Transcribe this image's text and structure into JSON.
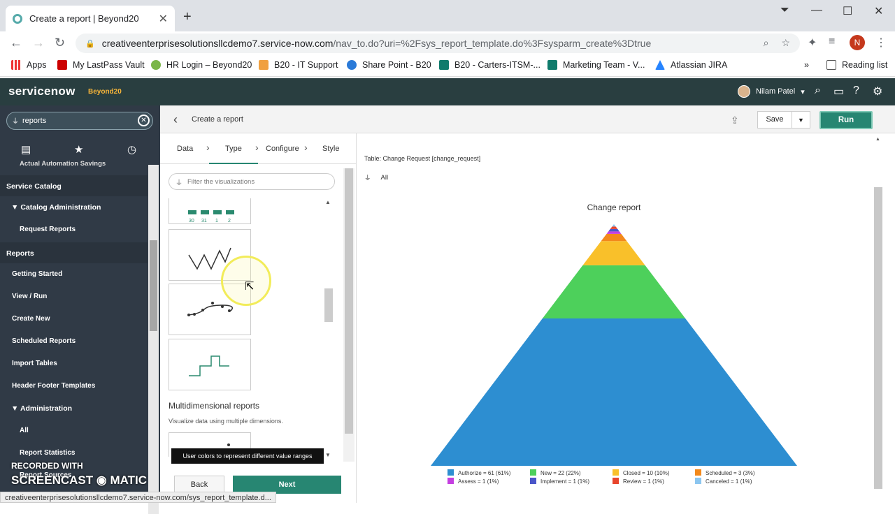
{
  "browser": {
    "tab_title": "Create a report | Beyond20",
    "url_host": "creativeenterprisesolutionsllcdemo7.service-now.com",
    "url_path": "/nav_to.do?uri=%2Fsys_report_template.do%3Fsysparm_create%3Dtrue",
    "profile_initial": "N",
    "bookmarks": [
      "Apps",
      "My LastPass Vault",
      "HR Login – Beyond20",
      "B20 - IT Support",
      "Share Point - B20",
      "B20 - Carters-ITSM-...",
      "Marketing Team - V...",
      "Atlassian JIRA"
    ],
    "reading_list": "Reading list"
  },
  "sn_header": {
    "logo": "servicenow",
    "instance": "Beyond20",
    "user_name": "Nilam Patel"
  },
  "leftnav": {
    "filter_value": "reports",
    "items": [
      {
        "label": "Actual Automation Savings",
        "type": "module"
      },
      {
        "label": "Service Catalog",
        "type": "section"
      },
      {
        "label": "Catalog Administration",
        "type": "group"
      },
      {
        "label": "Request Reports",
        "type": "module"
      },
      {
        "label": "Reports",
        "type": "section"
      },
      {
        "label": "Getting Started",
        "type": "module"
      },
      {
        "label": "View / Run",
        "type": "module"
      },
      {
        "label": "Create New",
        "type": "module"
      },
      {
        "label": "Scheduled Reports",
        "type": "module"
      },
      {
        "label": "Import Tables",
        "type": "module"
      },
      {
        "label": "Header Footer Templates",
        "type": "module"
      },
      {
        "label": "Administration",
        "type": "group"
      },
      {
        "label": "All",
        "type": "module"
      },
      {
        "label": "Report Statistics",
        "type": "module"
      },
      {
        "label": "Report Sources",
        "type": "module"
      }
    ]
  },
  "content": {
    "page_title": "Create a report",
    "save_label": "Save",
    "run_label": "Run",
    "steps": [
      "Data",
      "Type",
      "Configure",
      "Style"
    ],
    "viz_filter_placeholder": "Filter the visualizations",
    "mini_numbers": [
      "30",
      "31",
      "1",
      "2"
    ],
    "multi_title": "Multidimensional reports",
    "multi_sub": "Visualize data using multiple dimensions.",
    "tooltip": "User colors to represent different value ranges",
    "back_label": "Back",
    "next_label": "Next",
    "table_info": "Table: Change Request [change_request]",
    "filter_label": "All"
  },
  "chart_data": {
    "type": "pyramid",
    "title": "Change report",
    "series": [
      {
        "name": "Authorize = 61 (61%)",
        "category": "Authorize",
        "value": 61,
        "color": "#2d8ed1"
      },
      {
        "name": "New = 22 (22%)",
        "category": "New",
        "value": 22,
        "color": "#4dd05b"
      },
      {
        "name": "Closed = 10 (10%)",
        "category": "Closed",
        "value": 10,
        "color": "#f9c02a"
      },
      {
        "name": "Scheduled = 3 (3%)",
        "category": "Scheduled",
        "value": 3,
        "color": "#f2891c"
      },
      {
        "name": "Assess = 1 (1%)",
        "category": "Assess",
        "value": 1,
        "color": "#c43ee0"
      },
      {
        "name": "Implement = 1 (1%)",
        "category": "Implement",
        "value": 1,
        "color": "#4a55c9"
      },
      {
        "name": "Review = 1 (1%)",
        "category": "Review",
        "value": 1,
        "color": "#e8452c"
      },
      {
        "name": "Canceled = 1 (1%)",
        "category": "Canceled",
        "value": 1,
        "color": "#8cc6f0"
      }
    ],
    "legend_position": "bottom"
  },
  "watermark": {
    "line1": "RECORDED WITH",
    "line2": "SCREENCAST",
    "line3": "MATIC"
  },
  "status_url": "creativeenterprisesolutionsllcdemo7.service-now.com/sys_report_template.d..."
}
